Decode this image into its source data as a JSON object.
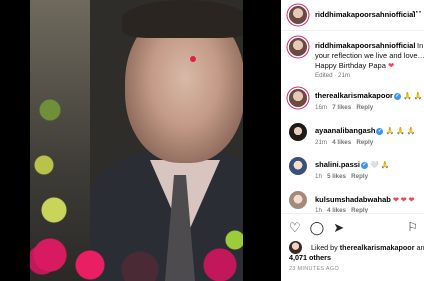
{
  "post": {
    "author": "riddhimakapoorsahniofficial",
    "more_icon": "ellipsis-icon",
    "caption_line1": "In",
    "caption_line2": "your reflection we live and love…",
    "caption_line3": "Happy Birthday Papa",
    "caption_emoji": "❤",
    "caption_meta": "Edited · 21m"
  },
  "comments": [
    {
      "user": "therealkarismakapoor",
      "verified": true,
      "text": "🙏 🙏 🔔",
      "time": "16m",
      "likes": "7 likes",
      "reply": "Reply"
    },
    {
      "user": "ayaanalibangash",
      "verified": true,
      "text": "🙏 🙏 🙏",
      "time": "21m",
      "likes": "4 likes",
      "reply": "Reply"
    },
    {
      "user": "shalini.passi",
      "verified": true,
      "text": "🤍 🙏",
      "time": "1h",
      "likes": "5 likes",
      "reply": "Reply"
    },
    {
      "user": "kulsumshadabwahab",
      "verified": false,
      "text": "❤ ❤ ❤",
      "time": "1h",
      "likes": "4 likes",
      "reply": "Reply"
    }
  ],
  "actions": {
    "like_icon": "heart-icon",
    "comment_icon": "comment-icon",
    "share_icon": "share-icon",
    "save_icon": "bookmark-icon"
  },
  "likes": {
    "prefix": "Liked by",
    "user": "therealkarismakapoor",
    "and": "and",
    "count": "4,071 others"
  },
  "timestamp": "23 MINUTES AGO",
  "colors": {
    "verified": "#3897f0",
    "heart": "#ed4956",
    "ring": "#d62976"
  }
}
